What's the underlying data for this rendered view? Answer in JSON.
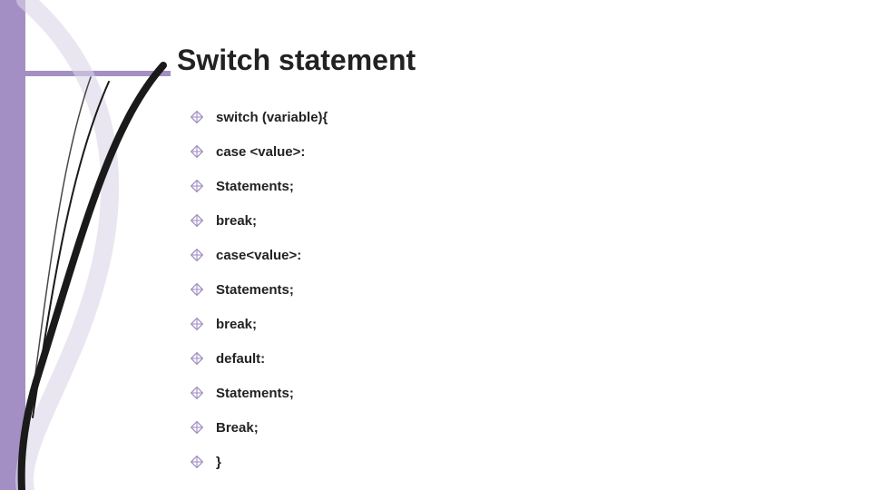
{
  "accent": "#a38fc4",
  "title": "Switch statement",
  "bullets": [
    "switch (variable){",
    "case <value>:",
    "Statements;",
    "break;",
    "case<value>:",
    "Statements;",
    "break;",
    "default:",
    "Statements;",
    "Break;",
    "}"
  ]
}
